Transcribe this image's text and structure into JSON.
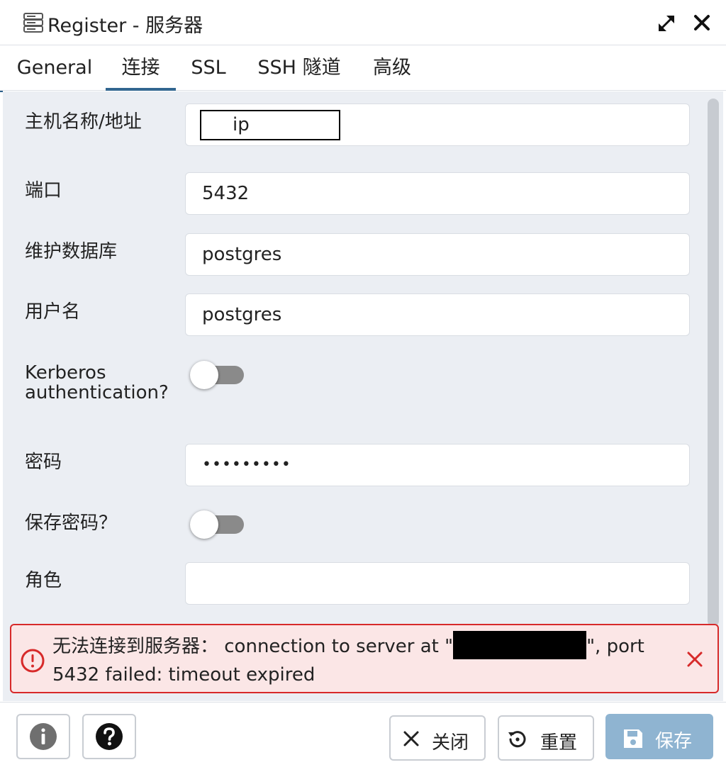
{
  "dialog": {
    "title": "Register - 服务器"
  },
  "tabs": [
    {
      "label": "General"
    },
    {
      "label": "连接"
    },
    {
      "label": "SSL"
    },
    {
      "label": "SSH 隧道"
    },
    {
      "label": "高级"
    }
  ],
  "form": {
    "host": {
      "label": "主机名称/地址",
      "value": "ip"
    },
    "port": {
      "label": "端口",
      "value": "5432"
    },
    "maintenance_db": {
      "label": "维护数据库",
      "value": "postgres"
    },
    "username": {
      "label": "用户名",
      "value": "postgres"
    },
    "kerberos": {
      "label": "Kerberos authentication?",
      "enabled": false
    },
    "password": {
      "label": "密码",
      "value": "•••••••••"
    },
    "save_password": {
      "label": "保存密码？",
      "enabled": false
    },
    "role": {
      "label": "角色",
      "value": ""
    }
  },
  "alert": {
    "line1_prefix": "无法连接到服务器： connection to server at \"",
    "line1_suffix": "\", port",
    "line2": "5432 failed: timeout expired"
  },
  "footer": {
    "close_label": "关闭",
    "reset_label": "重置",
    "save_label": "保存"
  },
  "icons": {
    "title": "server-icon",
    "expand": "expand-icon",
    "close": "close-icon",
    "alert": "alert-circle-icon",
    "alert_close": "close-icon",
    "info": "info-icon",
    "help": "help-icon",
    "close_button": "x-icon",
    "reset_button": "history-icon",
    "save_button": "floppy-disk-icon"
  },
  "colors": {
    "tab_active": "#326690",
    "error_border": "#d72a2a",
    "error_background": "#fbe6e6",
    "save_button": "#8fb4d1"
  }
}
